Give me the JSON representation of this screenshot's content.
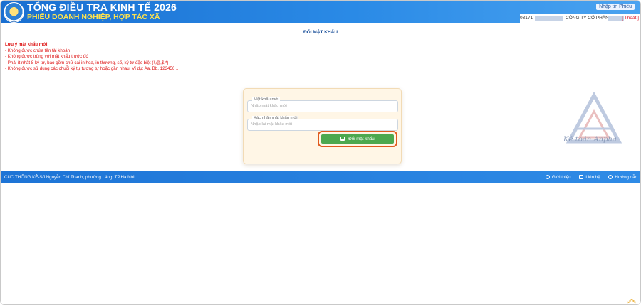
{
  "header": {
    "title": "TỔNG ĐIỀU TRA KINH TẾ 2026",
    "subtitle": "PHIẾU DOANH NGHIỆP, HỢP TÁC XÃ",
    "info_link": "Nhập tin Phiếu"
  },
  "user": {
    "id_prefix": "03171",
    "company": "CÔNG TY CỔ PHẦN",
    "logout": "[ Thoát ]"
  },
  "page": {
    "title": "ĐỔI MẬT KHẨU"
  },
  "notes": {
    "heading": "Lưu ý mật khẩu mới:",
    "items": [
      "- Không được chứa tên tài khoản",
      "- Không được trùng với mật khẩu trước đó",
      "- Phải ít nhất 8 ký tự, bao gồm chữ cái in hoa, in thường, số, ký tự đặc biệt (!,@,$,*)",
      "- Không được sử dụng các chuỗi ký tự tương tự hoặc gần nhau: Ví dụ: Aa, Bb, 123456 ..."
    ]
  },
  "form": {
    "new_password": {
      "label": "Mật khẩu mới",
      "placeholder": "Nhập mật khẩu mới"
    },
    "confirm_password": {
      "label": "Xác nhận mật khẩu mới",
      "placeholder": "Nhập lại mật khẩu mới"
    },
    "submit_label": "Đổi mật khẩu"
  },
  "watermark": {
    "text": "Kế toán Anpha"
  },
  "footer": {
    "address": "CỤC THỐNG KÊ-Số Nguyễn Chí Thanh, phường Láng, TP.Hà Nội",
    "links": [
      "Giới thiệu",
      "Liên hệ",
      "Hướng dẫn"
    ]
  },
  "colors": {
    "header_blue": "#1a6fd1",
    "subtitle_yellow": "#ffe34d",
    "note_red": "#d11111",
    "button_green": "#4ca84f",
    "highlight_orange": "#e05a1f"
  }
}
